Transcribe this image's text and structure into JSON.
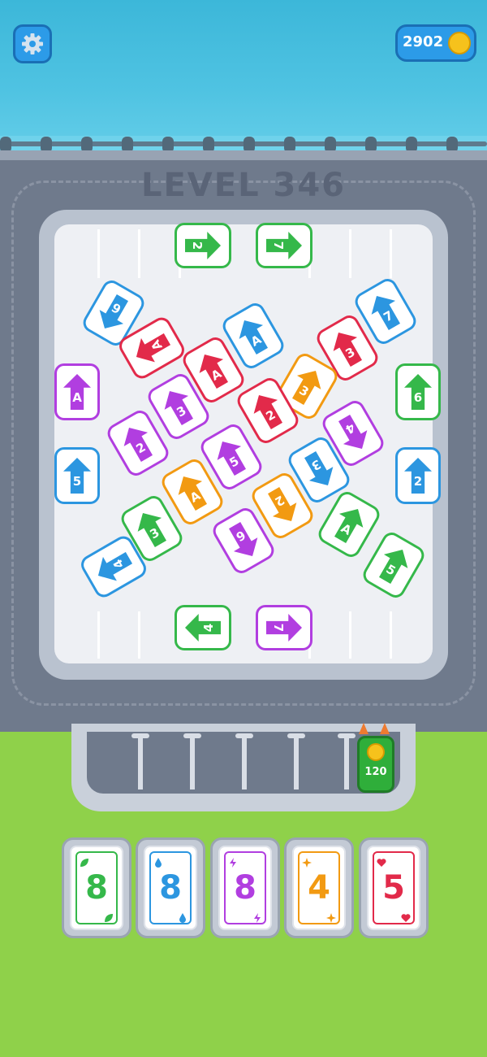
{
  "coins": {
    "value": "2902"
  },
  "level_title": "LEVEL 346",
  "bonus": {
    "cost": "120"
  },
  "colors": {
    "green": "#35b84a",
    "blue": "#2c96e0",
    "purple": "#b13ee0",
    "orange": "#f29a12",
    "red": "#e22a4a"
  },
  "cars": [
    {
      "label": "2",
      "color": "green",
      "rot": 90
    },
    {
      "label": "7",
      "color": "green",
      "rot": 90
    },
    {
      "label": "6",
      "color": "blue",
      "rot": -150
    },
    {
      "label": "7",
      "color": "blue",
      "rot": -30
    },
    {
      "label": "A",
      "color": "red",
      "rot": -120
    },
    {
      "label": "A",
      "color": "blue",
      "rot": -30
    },
    {
      "label": "3",
      "color": "red",
      "rot": -30
    },
    {
      "label": "A",
      "color": "purple",
      "rot": 0
    },
    {
      "label": "A",
      "color": "red",
      "rot": -30
    },
    {
      "label": "3",
      "color": "orange",
      "rot": 30
    },
    {
      "label": "6",
      "color": "green",
      "rot": 0
    },
    {
      "label": "3",
      "color": "purple",
      "rot": -30
    },
    {
      "label": "2",
      "color": "red",
      "rot": -30
    },
    {
      "label": "2",
      "color": "purple",
      "rot": -30
    },
    {
      "label": "5",
      "color": "purple",
      "rot": -30
    },
    {
      "label": "4",
      "color": "purple",
      "rot": 150
    },
    {
      "label": "5",
      "color": "blue",
      "rot": 0
    },
    {
      "label": "2",
      "color": "blue",
      "rot": 0
    },
    {
      "label": "3",
      "color": "blue",
      "rot": 150
    },
    {
      "label": "A",
      "color": "orange",
      "rot": -30
    },
    {
      "label": "2",
      "color": "orange",
      "rot": 150
    },
    {
      "label": "3",
      "color": "green",
      "rot": -30
    },
    {
      "label": "A",
      "color": "green",
      "rot": 30
    },
    {
      "label": "6",
      "color": "purple",
      "rot": 150
    },
    {
      "label": "4",
      "color": "blue",
      "rot": -120
    },
    {
      "label": "5",
      "color": "green",
      "rot": 30
    },
    {
      "label": "4",
      "color": "green",
      "rot": -90
    },
    {
      "label": "7",
      "color": "purple",
      "rot": 90
    }
  ],
  "slots": [
    {
      "value": "8",
      "color": "green",
      "suit": "leaf"
    },
    {
      "value": "8",
      "color": "blue",
      "suit": "drop"
    },
    {
      "value": "8",
      "color": "purple",
      "suit": "bolt"
    },
    {
      "value": "4",
      "color": "orange",
      "suit": "star"
    },
    {
      "value": "5",
      "color": "red",
      "suit": "heart"
    }
  ]
}
